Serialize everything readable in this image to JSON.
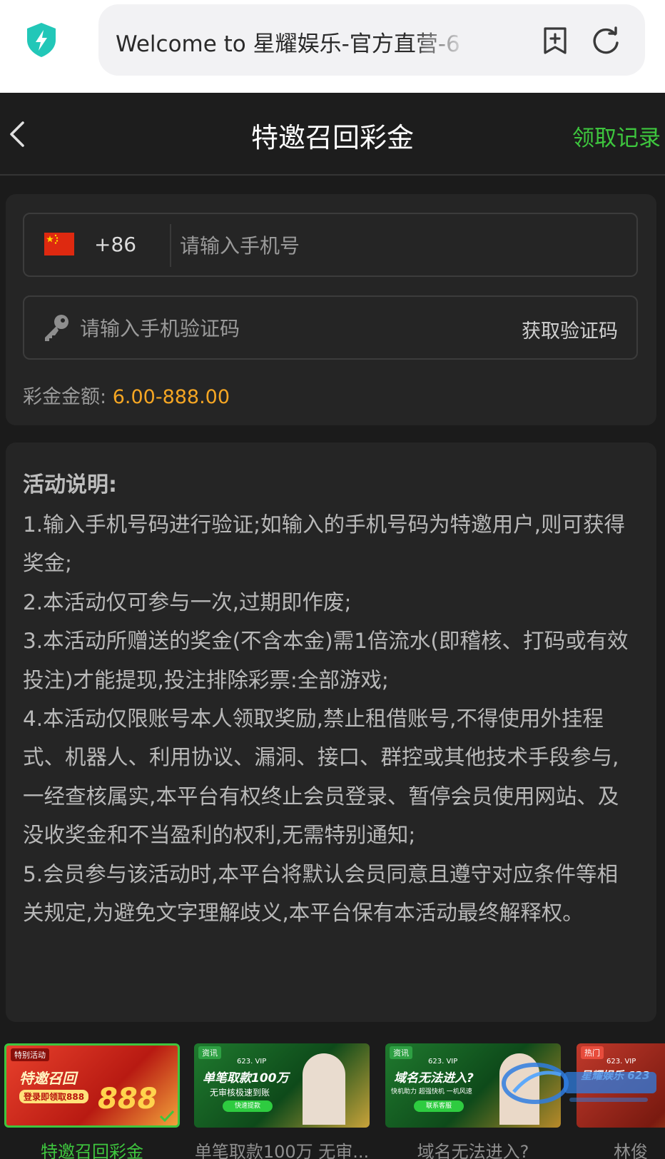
{
  "browser": {
    "url_title": "Welcome to 星耀娱乐-官方直营-6"
  },
  "header": {
    "title": "特邀召回彩金",
    "records_label": "领取记录"
  },
  "form": {
    "country_code": "+86",
    "phone_placeholder": "请输入手机号",
    "code_placeholder": "请输入手机验证码",
    "get_code_label": "获取验证码",
    "amount_label": "彩金金额:",
    "amount_value": "6.00-888.00"
  },
  "description": {
    "title": "活动说明:",
    "rules": [
      "1.输入手机号码进行验证;如输入的手机号码为特邀用户,则可获得奖金;",
      "2.本活动仅可参与一次,过期即作废;",
      "3.本活动所赠送的奖金(不含本金)需1倍流水(即稽核、打码或有效投注)才能提现,投注排除彩票:全部游戏;",
      "4.本活动仅限账号本人领取奖励,禁止租借账号,不得使用外挂程式、机器人、利用协议、漏洞、接口、群控或其他技术手段参与,一经查核属实,本平台有权终止会员登录、暂停会员使用网站、及没收奖金和不当盈利的权利,无需特别通知;",
      "5.会员参与该活动时,本平台将默认会员同意且遵守对应条件等相关规定,为避免文字理解歧义,本平台保有本活动最终解释权。"
    ]
  },
  "promos": [
    {
      "label": "特邀召回彩金",
      "tag": "特别活动",
      "line1": "特邀召回",
      "line2": "登录即领取888",
      "big": "888",
      "active": true
    },
    {
      "label": "单笔取款100万 无审...",
      "tag": "资讯",
      "vip": "623. VIP",
      "line1": "单笔取款100万",
      "line2": "无审核极速到账",
      "btn": "快速提款",
      "active": false
    },
    {
      "label": "域名无法进入?",
      "tag": "资讯",
      "vip": "623. VIP",
      "line1": "域名无法进入?",
      "line2": "快机助力 超强快机 一机风速",
      "btn": "联系客服",
      "active": false
    },
    {
      "label": "林俊",
      "tag": "热门",
      "vip": "623. VIP",
      "line1": "星耀娱乐 623",
      "line2": "",
      "active": false
    }
  ],
  "colors": {
    "accent_green": "#3ec63e",
    "amount_orange": "#f5a623",
    "background": "#1b1b1b",
    "card": "#252525"
  }
}
